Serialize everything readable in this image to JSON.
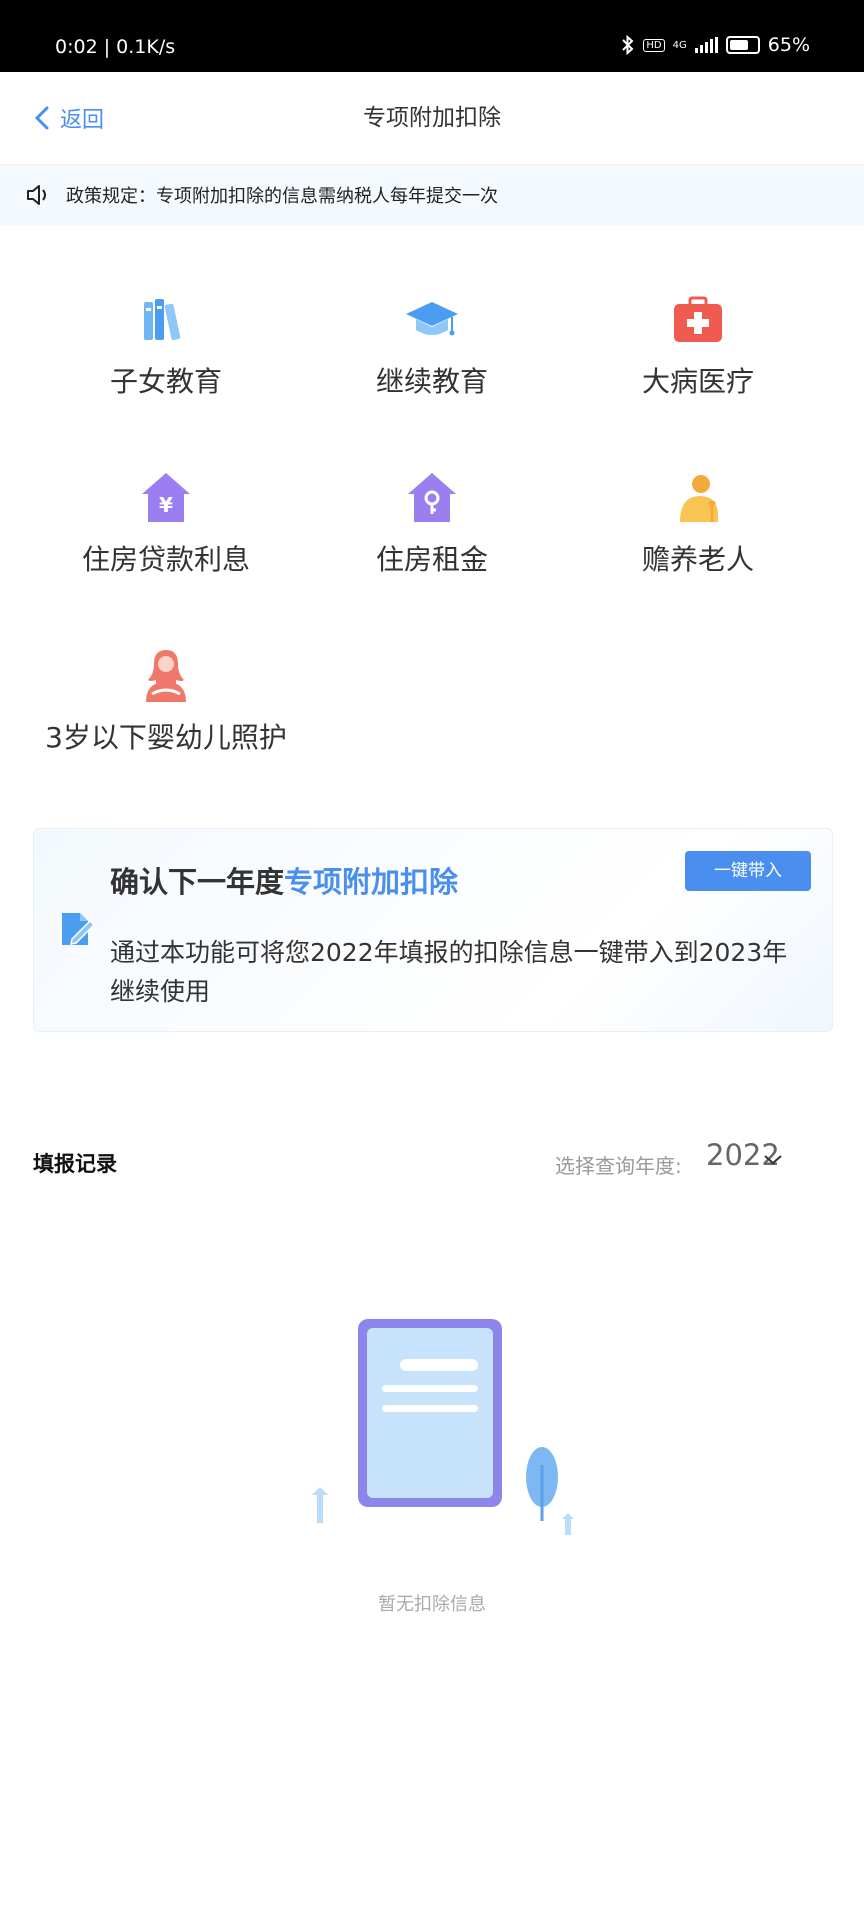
{
  "status_bar": {
    "time": "0:02 | 0.1K/s",
    "network": "4G",
    "battery": "65%"
  },
  "nav": {
    "back_label": "返回",
    "title": "专项附加扣除"
  },
  "notice": {
    "text": "政策规定：专项附加扣除的信息需纳税人每年提交一次"
  },
  "categories": [
    {
      "label": "子女教育",
      "icon": "books-icon"
    },
    {
      "label": "继续教育",
      "icon": "graduation-cap-icon"
    },
    {
      "label": "大病医疗",
      "icon": "medical-kit-icon"
    },
    {
      "label": "住房贷款利息",
      "icon": "house-yuan-icon"
    },
    {
      "label": "住房租金",
      "icon": "house-key-icon"
    },
    {
      "label": "赡养老人",
      "icon": "elderly-person-icon"
    },
    {
      "label": "3岁以下婴幼儿照护",
      "icon": "mother-baby-icon"
    }
  ],
  "card": {
    "title_plain": "确认下一年度",
    "title_highlight": "专项附加扣除",
    "description": "通过本功能可将您2022年填报的扣除信息一键带入到2023年继续使用",
    "button_label": "一键带入"
  },
  "records": {
    "title": "填报记录",
    "year_label": "选择查询年度:",
    "year_value": "2022",
    "empty_text": "暂无扣除信息"
  },
  "colors": {
    "accent": "#4a8ff0",
    "notice_bg": "#f4f9fd"
  }
}
